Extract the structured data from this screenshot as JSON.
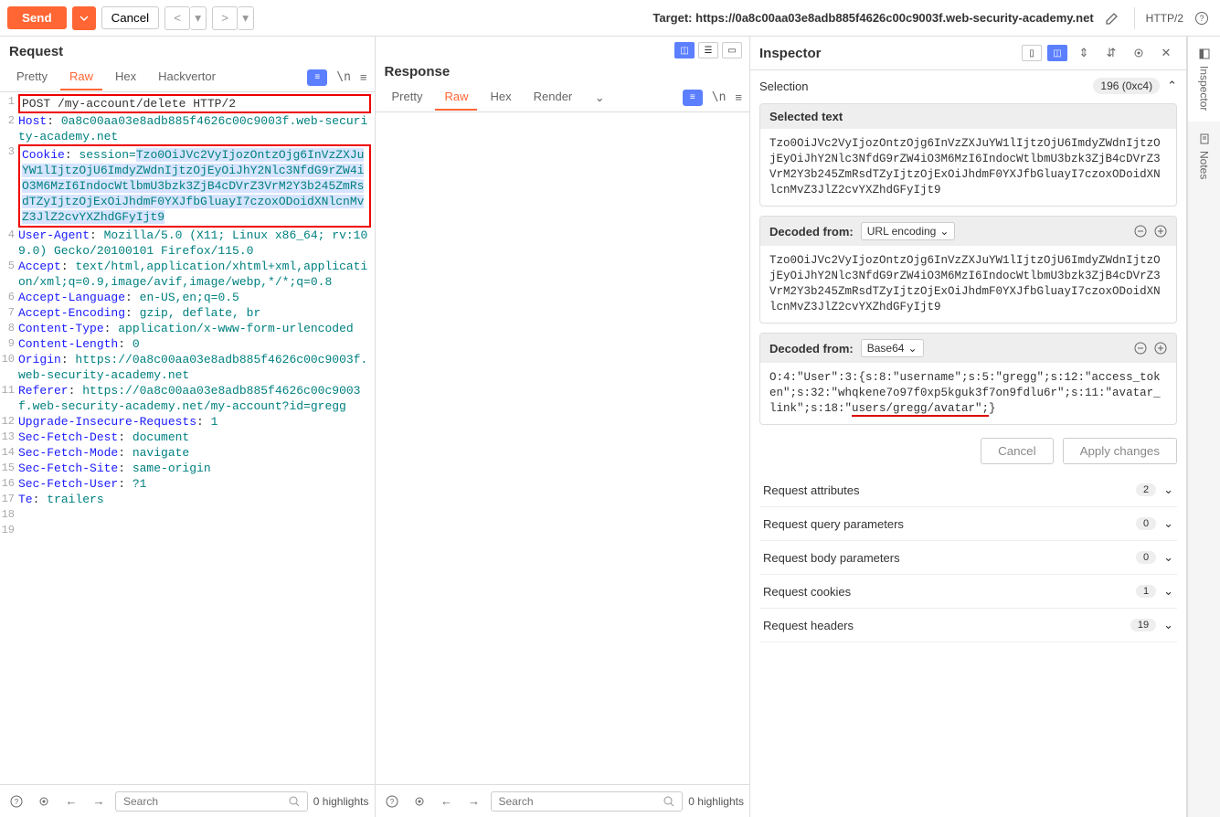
{
  "toolbar": {
    "send": "Send",
    "cancel": "Cancel",
    "target_prefix": "Target: ",
    "target": "https://0a8c00aa03e8adb885f4626c00c9003f.web-security-academy.net",
    "protocol": "HTTP/2"
  },
  "request": {
    "title": "Request",
    "tabs": [
      "Pretty",
      "Raw",
      "Hex",
      "Hackvertor"
    ],
    "active_tab": "Raw",
    "lines": [
      {
        "n": 1,
        "raw": "POST /my-account/delete HTTP/2",
        "boxed": true
      },
      {
        "n": 2,
        "key": "Host",
        "val": "0a8c00aa03e8adb885f4626c00c9003f.web-security-academy.net"
      },
      {
        "n": 3,
        "key": "Cookie",
        "val_prefix": "session=",
        "val_highlight": "Tzo0OiJVc2VyIjozOntzOjg6InVzZXJuYW1lIjtzOjU6ImdyZWdnIjtzOjEyOiJhY2Nlc3NfdG9rZW4iO3M6MzI6IndocWtlbmU3bzk3ZjB4cDVrZ3VrM2Y3b245ZmRsdTZyIjtzOjExOiJhdmF0YXJfbGluayI7czoxODoidXNlcnMvZ3JlZ2cvYXZhdGFyIjt9",
        "boxed": true
      },
      {
        "n": 4,
        "key": "User-Agent",
        "val": "Mozilla/5.0 (X11; Linux x86_64; rv:109.0) Gecko/20100101 Firefox/115.0"
      },
      {
        "n": 5,
        "key": "Accept",
        "val": "text/html,application/xhtml+xml,application/xml;q=0.9,image/avif,image/webp,*/*;q=0.8"
      },
      {
        "n": 6,
        "key": "Accept-Language",
        "val": "en-US,en;q=0.5"
      },
      {
        "n": 7,
        "key": "Accept-Encoding",
        "val": "gzip, deflate, br"
      },
      {
        "n": 8,
        "key": "Content-Type",
        "val": "application/x-www-form-urlencoded"
      },
      {
        "n": 9,
        "key": "Content-Length",
        "val": "0"
      },
      {
        "n": 10,
        "key": "Origin",
        "val": "https://0a8c00aa03e8adb885f4626c00c9003f.web-security-academy.net"
      },
      {
        "n": 11,
        "key": "Referer",
        "val": "https://0a8c00aa03e8adb885f4626c00c9003f.web-security-academy.net/my-account?id=gregg"
      },
      {
        "n": 12,
        "key": "Upgrade-Insecure-Requests",
        "val": "1"
      },
      {
        "n": 13,
        "key": "Sec-Fetch-Dest",
        "val": "document"
      },
      {
        "n": 14,
        "key": "Sec-Fetch-Mode",
        "val": "navigate"
      },
      {
        "n": 15,
        "key": "Sec-Fetch-Site",
        "val": "same-origin"
      },
      {
        "n": 16,
        "key": "Sec-Fetch-User",
        "val": "?1"
      },
      {
        "n": 17,
        "key": "Te",
        "val": "trailers"
      },
      {
        "n": 18,
        "raw": ""
      },
      {
        "n": 19,
        "raw": ""
      }
    ],
    "search_placeholder": "Search",
    "highlights": "0 highlights"
  },
  "response": {
    "title": "Response",
    "tabs": [
      "Pretty",
      "Raw",
      "Hex",
      "Render"
    ],
    "active_tab": "Raw",
    "search_placeholder": "Search",
    "highlights": "0 highlights"
  },
  "inspector": {
    "title": "Inspector",
    "selection_label": "Selection",
    "selection_badge": "196 (0xc4)",
    "selected_text_label": "Selected text",
    "selected_text": "Tzo0OiJVc2VyIjozOntzOjg6InVzZXJuYW1lIjtzOjU6ImdyZWdnIjtzOjEyOiJhY2Nlc3NfdG9rZW4iO3M6MzI6IndocWtlbmU3bzk3ZjB4cDVrZ3VrM2Y3b245ZmRsdTZyIjtzOjExOiJhdmF0YXJfbGluayI7czoxODoidXNlcnMvZ3JlZ2cvYXZhdGFyIjt9",
    "decoded1_label": "Decoded from:",
    "decoded1_type": "URL encoding",
    "decoded1_text": "Tzo0OiJVc2VyIjozOntzOjg6InVzZXJuYW1lIjtzOjU6ImdyZWdnIjtzOjEyOiJhY2Nlc3NfdG9rZW4iO3M6MzI6IndocWtlbmU3bzk3ZjB4cDVrZ3VrM2Y3b245ZmRsdTZyIjtzOjExOiJhdmF0YXJfbGluayI7czoxODoidXNlcnMvZ3JlZ2cvYXZhdGFyIjt9",
    "decoded2_label": "Decoded from:",
    "decoded2_type": "Base64",
    "decoded2_pre": "O:4:\"User\":3:{s:8:\"username\";s:5:\"gregg\";s:12:\"access_token\";s:32:\"whqkene7o97f0xp5kguk3f7on9fdlu6r\";s:11:\"avatar_link\";s:18:\"",
    "decoded2_underlined": "users/gregg/avatar\";",
    "decoded2_post": "}",
    "cancel": "Cancel",
    "apply": "Apply changes",
    "attrs": [
      {
        "label": "Request attributes",
        "count": "2"
      },
      {
        "label": "Request query parameters",
        "count": "0"
      },
      {
        "label": "Request body parameters",
        "count": "0"
      },
      {
        "label": "Request cookies",
        "count": "1"
      },
      {
        "label": "Request headers",
        "count": "19"
      }
    ]
  },
  "sidebar": {
    "inspector": "Inspector",
    "notes": "Notes"
  }
}
